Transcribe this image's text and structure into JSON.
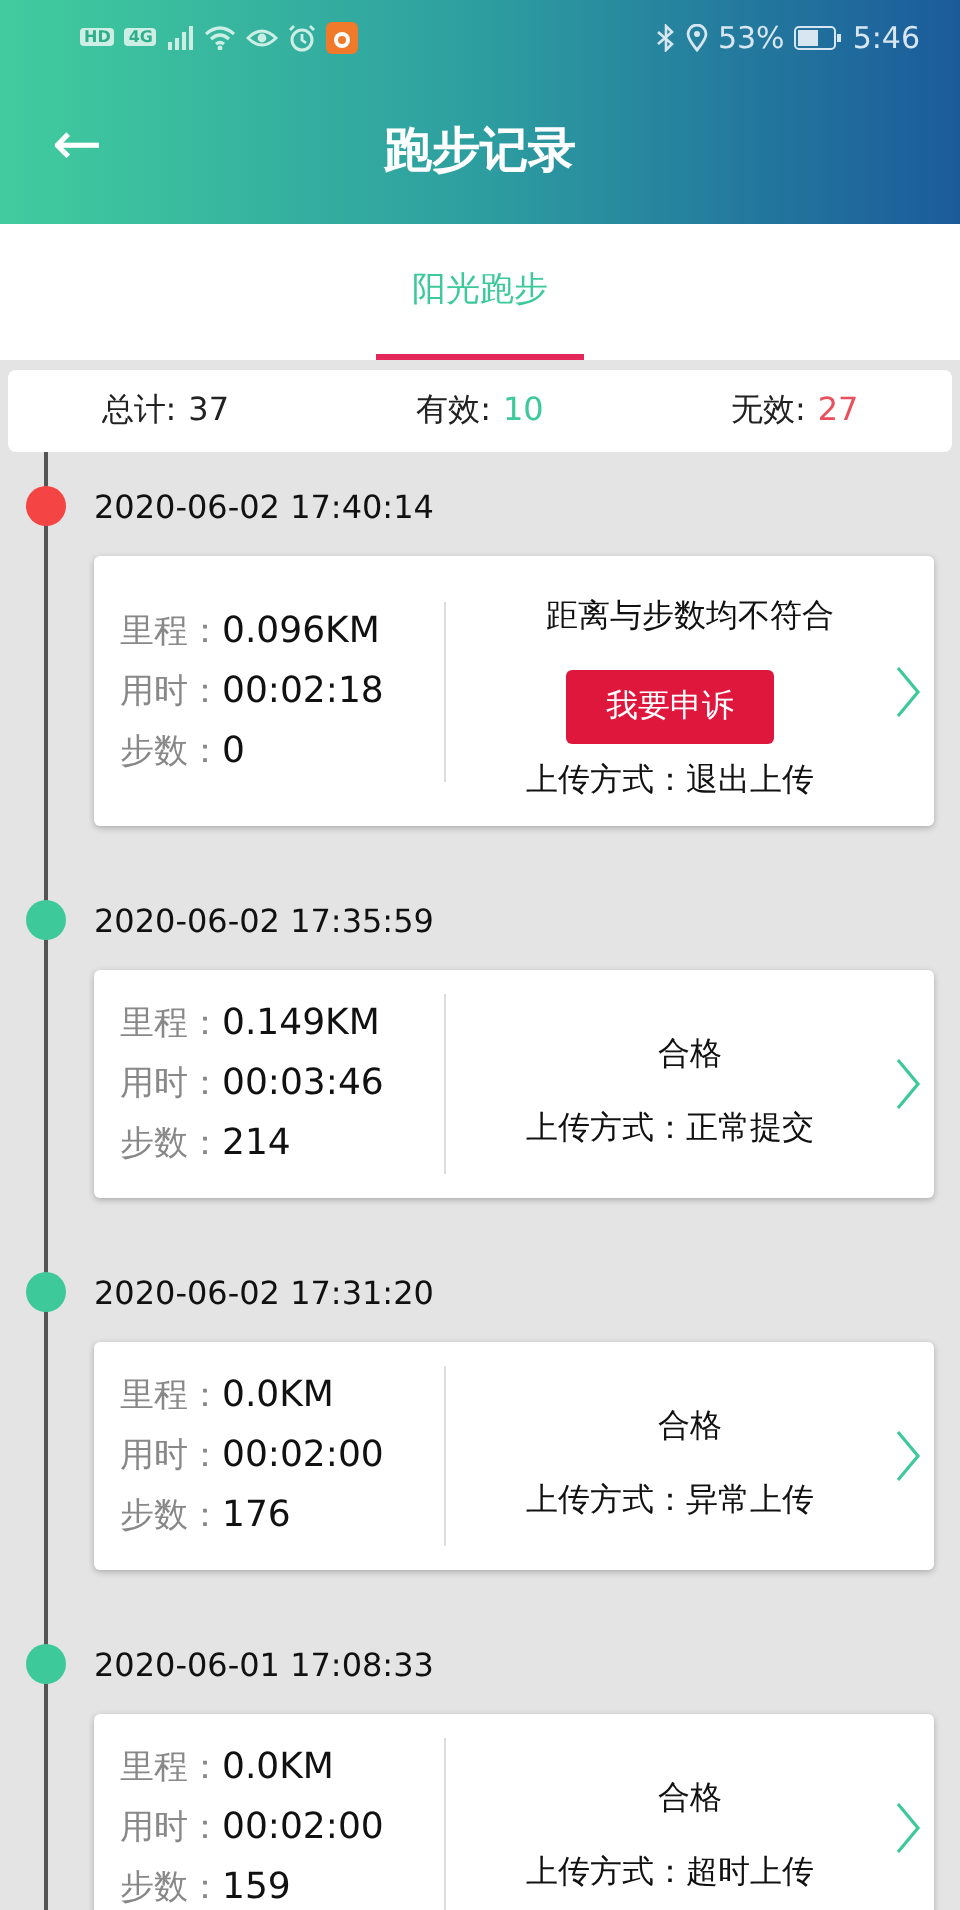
{
  "status_bar": {
    "network_badges": [
      "HD",
      "4G"
    ],
    "battery": "53%",
    "time": "5:46"
  },
  "header": {
    "back_icon": "←",
    "title": "跑步记录"
  },
  "tabs": [
    {
      "label": "阳光跑步",
      "selected": true
    }
  ],
  "summary": [
    {
      "label": "总计:",
      "value": "37",
      "kind": "total"
    },
    {
      "label": "有效:",
      "value": "10",
      "kind": "valid"
    },
    {
      "label": "无效:",
      "value": "27",
      "kind": "invalid"
    }
  ],
  "records": [
    {
      "time": "2020-06-02 17:40:14",
      "color": "#f44444",
      "stats": [
        {
          "label": "里程：",
          "value": "0.096KM"
        },
        {
          "label": "用时：",
          "value": "00:02:18"
        },
        {
          "label": "步数：",
          "value": "0"
        }
      ],
      "status": "距离与步数均不符合",
      "appeal": "我要申诉",
      "upload": "上传方式：退出上传"
    },
    {
      "time": "2020-06-02 17:35:59",
      "color": "#3ec99a",
      "stats": [
        {
          "label": "里程：",
          "value": "0.149KM"
        },
        {
          "label": "用时：",
          "value": "00:03:46"
        },
        {
          "label": "步数：",
          "value": "214"
        }
      ],
      "status": "合格",
      "upload": "上传方式：正常提交"
    },
    {
      "time": "2020-06-02 17:31:20",
      "color": "#3ec99a",
      "stats": [
        {
          "label": "里程：",
          "value": "0.0KM"
        },
        {
          "label": "用时：",
          "value": "00:02:00"
        },
        {
          "label": "步数：",
          "value": "176"
        }
      ],
      "status": "合格",
      "upload": "上传方式：异常上传"
    },
    {
      "time": "2020-06-01 17:08:33",
      "color": "#3ec99a",
      "stats": [
        {
          "label": "里程：",
          "value": "0.0KM"
        },
        {
          "label": "用时：",
          "value": "00:02:00"
        },
        {
          "label": "步数：",
          "value": "159"
        }
      ],
      "status": "合格",
      "upload": "上传方式：超时上传"
    }
  ]
}
